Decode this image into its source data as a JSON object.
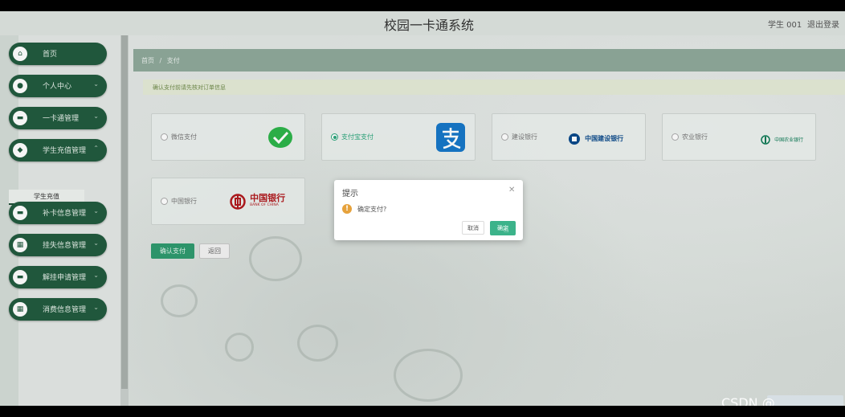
{
  "header": {
    "title": "校园一卡通系统",
    "user": "学生 001",
    "logout": "退出登录"
  },
  "sidebar": {
    "items": [
      {
        "label": "首页",
        "icon": "home-icon",
        "has_submenu": false
      },
      {
        "label": "个人中心",
        "icon": "user-icon",
        "has_submenu": true
      },
      {
        "label": "一卡通管理",
        "icon": "monitor-icon",
        "has_submenu": true
      },
      {
        "label": "学生充值管理",
        "icon": "location-icon",
        "has_submenu": true
      },
      {
        "label": "补卡信息管理",
        "icon": "monitor-icon",
        "has_submenu": true
      },
      {
        "label": "挂失信息管理",
        "icon": "grid-icon",
        "has_submenu": true
      },
      {
        "label": "解挂申请管理",
        "icon": "monitor-icon",
        "has_submenu": true
      },
      {
        "label": "消费信息管理",
        "icon": "grid-icon",
        "has_submenu": true
      }
    ],
    "open_submenu": "学生充值"
  },
  "breadcrumb": {
    "home": "首页",
    "separator": "/",
    "current": "支付"
  },
  "notice": "确认支付前请先核对订单信息",
  "payment_options": [
    {
      "label": "微信支付",
      "logo": "wechat-logo",
      "selected": false
    },
    {
      "label": "支付宝支付",
      "logo": "alipay-logo",
      "selected": true
    },
    {
      "label": "建设银行",
      "logo": "ccb-logo",
      "selected": false,
      "logo_text": "中国建设银行"
    },
    {
      "label": "农业银行",
      "logo": "abc-logo",
      "selected": false,
      "logo_text": "中国农业银行"
    },
    {
      "label": "中国银行",
      "logo": "boc-logo",
      "selected": false,
      "logo_text": "中国银行",
      "logo_subtext": "BANK OF CHINA"
    }
  ],
  "buttons": {
    "confirm": "确认支付",
    "back": "返回"
  },
  "dialog": {
    "title": "提示",
    "message": "确定支付?",
    "cancel": "取消",
    "ok": "确定"
  },
  "watermark": "CSDN @",
  "colors": {
    "primary": "#225b3f",
    "accent": "#2aa57b",
    "header_bar": "#8fa99b",
    "warning": "#e6a23c"
  }
}
